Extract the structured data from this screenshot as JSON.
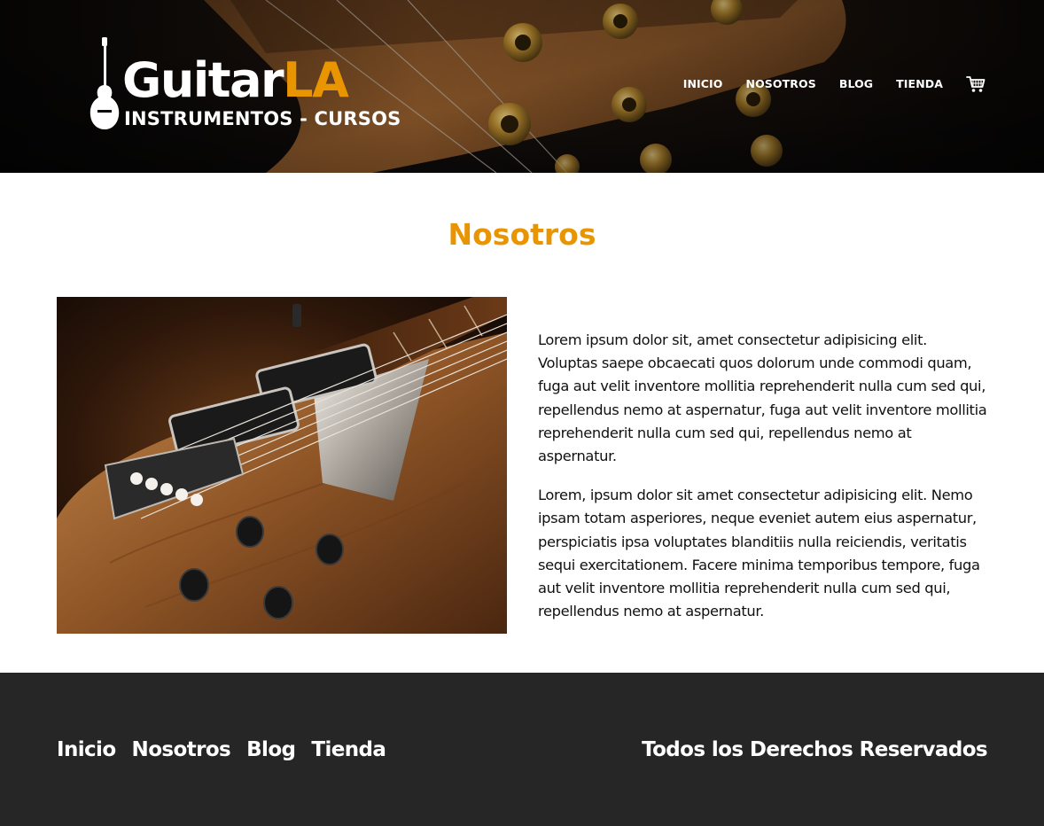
{
  "brand": {
    "name_main": "Guitar",
    "name_accent": "LA",
    "tagline": "INSTRUMENTOS - CURSOS",
    "accent_color": "#e99401"
  },
  "header": {
    "nav": [
      {
        "label": "INICIO"
      },
      {
        "label": "NOSOTROS"
      },
      {
        "label": "BLOG"
      },
      {
        "label": "TIENDA"
      }
    ],
    "cart_icon": "shopping-cart-icon"
  },
  "main": {
    "title": "Nosotros",
    "paragraphs": [
      "Lorem ipsum dolor sit, amet consectetur adipisicing elit. Voluptas saepe obcaecati quos dolorum unde commodi quam, fuga aut velit inventore mollitia reprehenderit nulla cum sed qui, repellendus nemo at aspernatur, fuga aut velit inventore mollitia reprehenderit nulla cum sed qui, repellendus nemo at aspernatur.",
      "Lorem, ipsum dolor sit amet consectetur adipisicing elit. Nemo ipsam totam asperiores, neque eveniet autem eius aspernatur, perspiciatis ipsa voluptates blanditiis nulla reiciendis, veritatis sequi exercitationem. Facere minima temporibus tempore, fuga aut velit inventore mollitia reprehenderit nulla cum sed qui, repellendus nemo at aspernatur."
    ]
  },
  "footer": {
    "nav": [
      {
        "label": "Inicio"
      },
      {
        "label": "Nosotros"
      },
      {
        "label": "Blog"
      },
      {
        "label": "Tienda"
      }
    ],
    "copyright": "Todos los Derechos Reservados",
    "background": "#262626"
  }
}
